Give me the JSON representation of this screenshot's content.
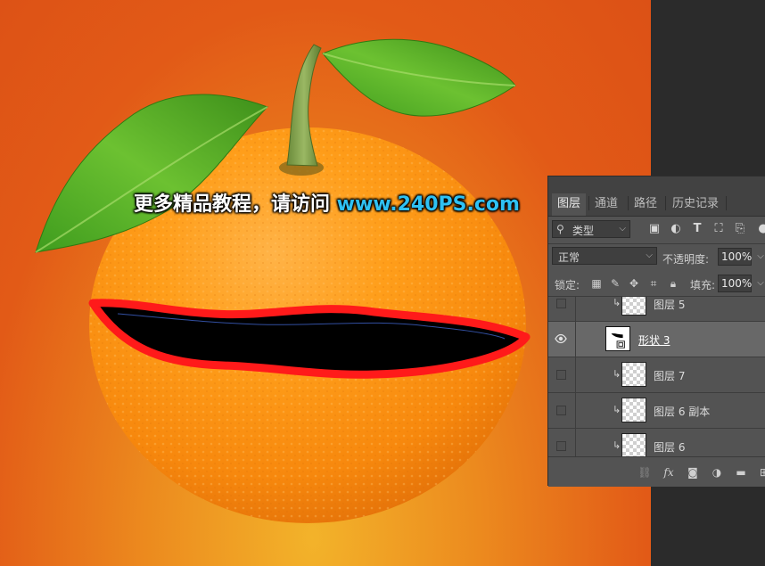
{
  "watermark": {
    "text": "更多精品教程，请访问 ",
    "url": "www.240PS.com"
  },
  "layers_panel": {
    "tabs": [
      "图层",
      "通道",
      "路径",
      "历史记录"
    ],
    "active_tab": "图层",
    "filter": {
      "kind_label": "类型",
      "icons": [
        "image-filter-icon",
        "adjustment-filter-icon",
        "text-filter-icon",
        "shape-filter-icon",
        "smart-object-filter-icon"
      ]
    },
    "blend_mode": "正常",
    "opacity_label": "不透明度:",
    "opacity_value": "100%",
    "lock_label": "锁定:",
    "fill_label": "填充:",
    "fill_value": "100%",
    "layers": [
      {
        "name": "图层 5",
        "visible": false,
        "clipped": true,
        "selected": false,
        "kind": "pixel"
      },
      {
        "name": "形状 3",
        "visible": true,
        "clipped": false,
        "selected": true,
        "kind": "shape"
      },
      {
        "name": "图层 7",
        "visible": false,
        "clipped": true,
        "selected": false,
        "kind": "pixel"
      },
      {
        "name": "图层 6 副本",
        "visible": false,
        "clipped": true,
        "selected": false,
        "kind": "pixel"
      },
      {
        "name": "图层 6",
        "visible": false,
        "clipped": true,
        "selected": false,
        "kind": "pixel"
      }
    ],
    "bottom_icons": [
      "link-icon",
      "fx-icon",
      "mask-icon",
      "adjustment-icon",
      "group-icon",
      "new-layer-icon"
    ],
    "fx_label": "fx"
  },
  "colors": {
    "background": "#e25a17",
    "shape_stroke": "#ff1a1a",
    "shape_fill": "#000000",
    "watermark_url": "#2fc1f3",
    "panel_bg": "#535353",
    "pasteboard": "#2b2b2b"
  }
}
